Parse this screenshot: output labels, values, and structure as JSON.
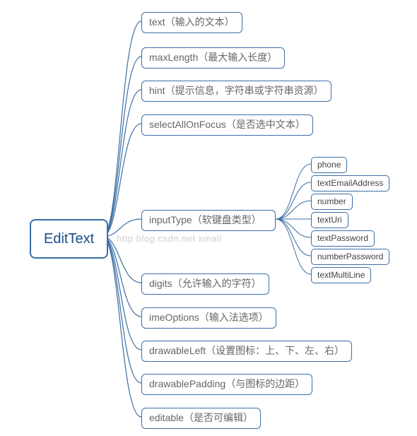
{
  "root": {
    "label": "EditText"
  },
  "attrs": [
    {
      "label": "text（输入的文本）"
    },
    {
      "label": "maxLength（最大输入长度）"
    },
    {
      "label": "hint（提示信息，字符串或字符串资源）"
    },
    {
      "label": "selectAllOnFocus（是否选中文本）"
    },
    {
      "label": "inputType（软键盘类型）"
    },
    {
      "label": "digits（允许输入的字符）"
    },
    {
      "label": "imeOptions（输入法选项）"
    },
    {
      "label": "drawableLeft（设置图标：上、下、左、右）"
    },
    {
      "label": "drawablePadding（与图标的边距）"
    },
    {
      "label": "editable（是否可编辑）"
    }
  ],
  "inputTypeOptions": [
    {
      "label": "phone"
    },
    {
      "label": "textEmailAddress"
    },
    {
      "label": "number"
    },
    {
      "label": "textUri"
    },
    {
      "label": "textPassword"
    },
    {
      "label": "numberPassword"
    },
    {
      "label": "textMultiLine"
    }
  ],
  "watermark": "http blog.csdn.net small",
  "colors": {
    "border": "#3b6ea5",
    "line": "#3b6ea5",
    "text": "#555"
  }
}
